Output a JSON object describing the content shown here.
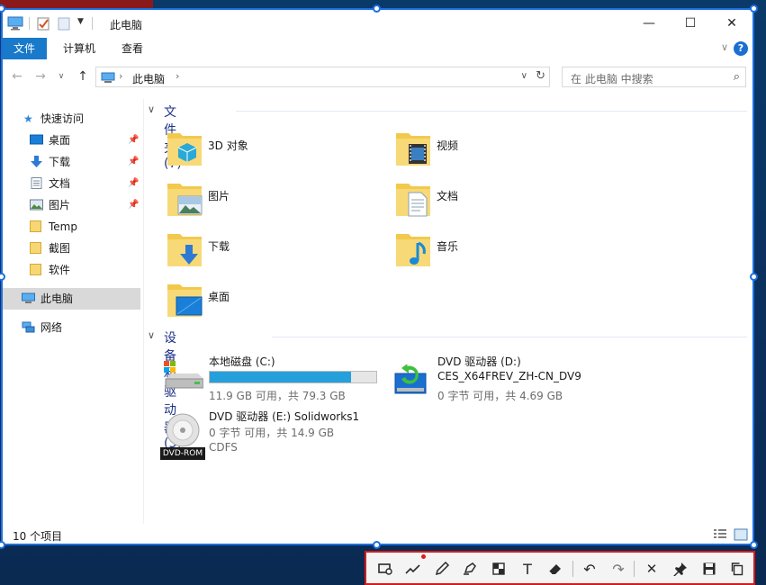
{
  "window": {
    "title": "此电脑",
    "controls": {
      "minimize": "—",
      "maximize": "☐",
      "close": "✕"
    }
  },
  "ribbon": {
    "tabs": [
      {
        "label": "文件",
        "active": true
      },
      {
        "label": "计算机",
        "active": false
      },
      {
        "label": "查看",
        "active": false
      }
    ],
    "help": "?"
  },
  "address": {
    "path": "此电脑",
    "search_placeholder": "在 此电脑 中搜索"
  },
  "navigation": {
    "quick_access": "快速访问",
    "items": [
      {
        "label": "桌面",
        "pinned": true,
        "icon": "desktop-icon"
      },
      {
        "label": "下载",
        "pinned": true,
        "icon": "download-arrow-icon"
      },
      {
        "label": "文档",
        "pinned": true,
        "icon": "document-icon"
      },
      {
        "label": "图片",
        "pinned": true,
        "icon": "picture-icon"
      },
      {
        "label": "Temp",
        "pinned": false,
        "icon": "folder-icon"
      },
      {
        "label": "截图",
        "pinned": false,
        "icon": "folder-icon"
      },
      {
        "label": "软件",
        "pinned": false,
        "icon": "folder-icon"
      }
    ],
    "this_pc": "此电脑",
    "network": "网络"
  },
  "content": {
    "folders_heading": "文件夹 (7)",
    "folders": [
      {
        "label": "3D 对象",
        "icon": "3d-objects-folder-icon"
      },
      {
        "label": "视频",
        "icon": "videos-folder-icon"
      },
      {
        "label": "图片",
        "icon": "pictures-folder-icon"
      },
      {
        "label": "文档",
        "icon": "documents-folder-icon"
      },
      {
        "label": "下载",
        "icon": "downloads-folder-icon"
      },
      {
        "label": "音乐",
        "icon": "music-folder-icon"
      },
      {
        "label": "桌面",
        "icon": "desktop-folder-icon"
      }
    ],
    "drives_heading": "设备和驱动器 (3)",
    "drives": [
      {
        "name": "本地磁盘 (C:)",
        "detail": "11.9 GB 可用，共 79.3 GB",
        "used_fraction": 0.85
      },
      {
        "name": "DVD 驱动器 (D:)",
        "label": "CES_X64FREV_ZH-CN_DV9",
        "detail": "0 字节 可用，共 4.69 GB"
      },
      {
        "name": "DVD 驱动器 (E:) Solidworks1",
        "detail": "0 字节 可用，共 14.9 GB",
        "fs": "CDFS",
        "media_badge": "DVD-ROM"
      }
    ]
  },
  "status": {
    "item_count": "10 个项目"
  },
  "colors": {
    "accent": "#1979ca",
    "selection": "#1c6fe0",
    "capture_border": "#d41b1b",
    "usage_bar": "#26a0da",
    "heading": "#1e3287"
  },
  "capture_toolbar": {
    "tools": [
      "rectangle-tool-icon",
      "line-tool-icon",
      "pencil-tool-icon",
      "marker-tool-icon",
      "mosaic-tool-icon",
      "text-tool-icon",
      "eraser-tool-icon",
      "undo-icon",
      "redo-icon",
      "cancel-icon",
      "pin-icon",
      "save-icon",
      "copy-icon"
    ]
  }
}
